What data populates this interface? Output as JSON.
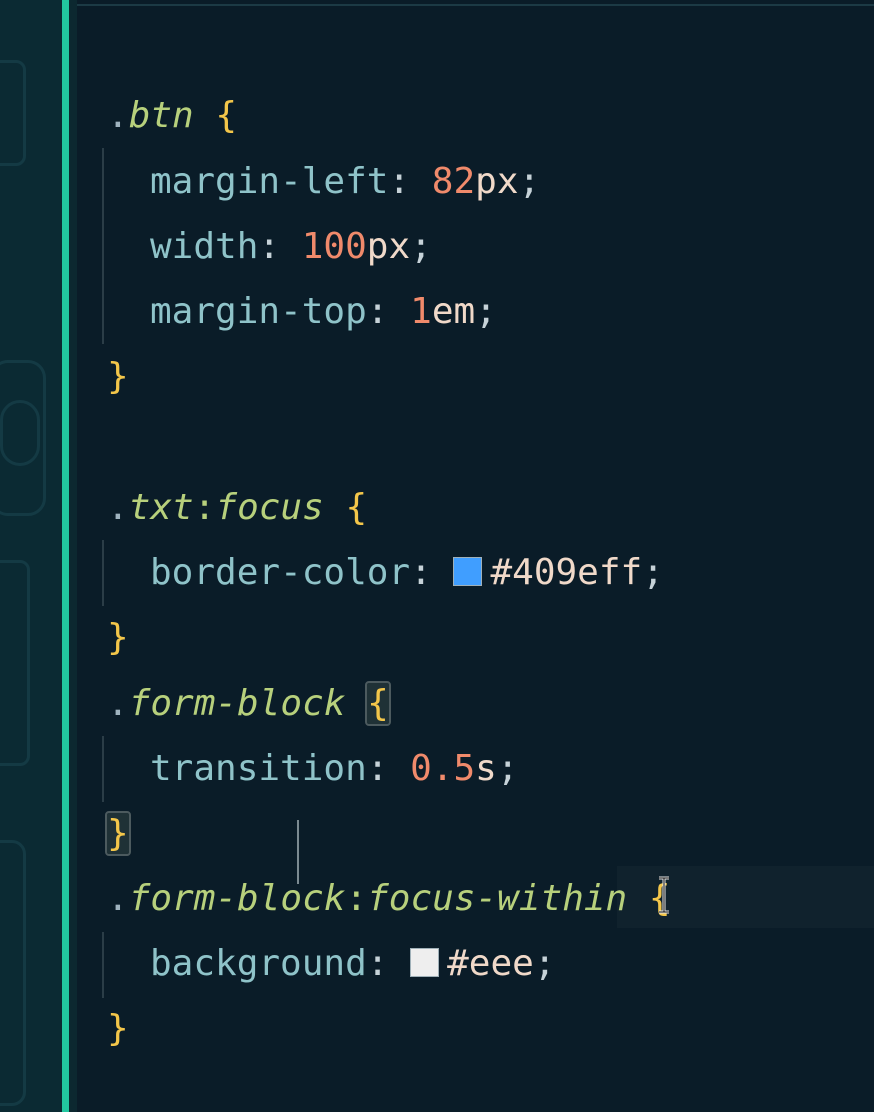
{
  "editor": {
    "colors": {
      "background": "#0a1c28",
      "accent_bar": "#22c7a0",
      "selector": "#b7d07c",
      "brace": "#f3c64a",
      "property": "#8fc3c9",
      "number": "#f08a6b"
    },
    "rules": [
      {
        "dot": ".",
        "selector": "btn",
        "open_brace": "{",
        "close_brace": "}",
        "declarations": [
          {
            "property": "margin-left",
            "colon": ":",
            "number": "82",
            "unit": "px",
            "semicolon": ";"
          },
          {
            "property": "width",
            "colon": ":",
            "number": "100",
            "unit": "px",
            "semicolon": ";"
          },
          {
            "property": "margin-top",
            "colon": ":",
            "number": "1",
            "unit": "em",
            "semicolon": ";"
          }
        ]
      },
      {
        "dot": ".",
        "selector": "txt",
        "pseudo_colon": ":",
        "pseudo": "focus",
        "open_brace": "{",
        "close_brace": "}",
        "declarations": [
          {
            "property": "border-color",
            "colon": ":",
            "swatch_color": "#409eff",
            "value": "#409eff",
            "semicolon": ";"
          }
        ]
      },
      {
        "dot": ".",
        "selector": "form-block",
        "open_brace": "{",
        "close_brace": "}",
        "declarations": [
          {
            "property": "transition",
            "colon": ":",
            "number": "0.5",
            "unit": "s",
            "semicolon": ";"
          }
        ]
      },
      {
        "dot": ".",
        "selector": "form-block",
        "pseudo_colon": ":",
        "pseudo": "focus-within",
        "open_brace": "{",
        "close_brace": "}",
        "declarations": [
          {
            "property": "background",
            "colon": ":",
            "swatch_color": "#eeeeee",
            "value": "#eee",
            "semicolon": ";"
          }
        ]
      }
    ]
  }
}
